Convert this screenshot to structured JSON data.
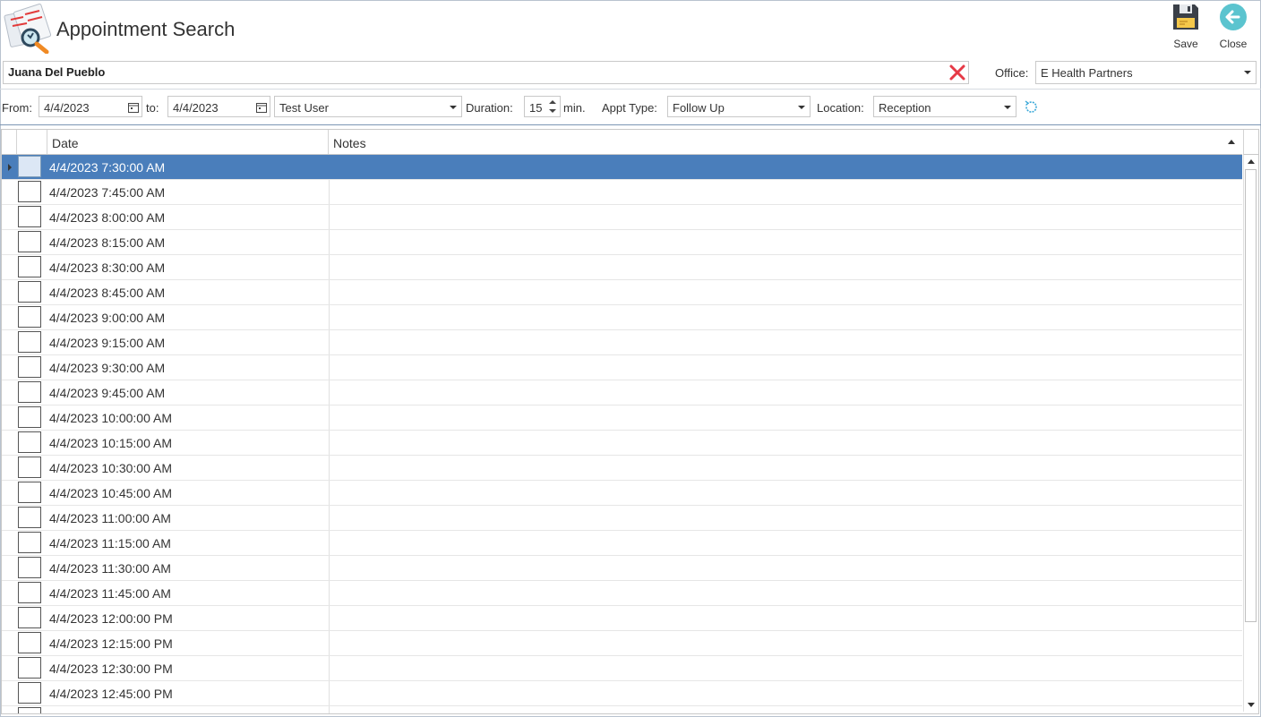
{
  "window": {
    "title": "Appointment Search"
  },
  "toolbar": {
    "save_label": "Save",
    "close_label": "Close"
  },
  "patient": {
    "name": "Juana Del Pueblo"
  },
  "office": {
    "label": "Office:",
    "value": "E Health Partners"
  },
  "filters": {
    "from_label": "From:",
    "from_date": "4/4/2023",
    "to_label": "to:",
    "to_date": "4/4/2023",
    "provider": "Test User",
    "duration_label": "Duration:",
    "duration_value": "15",
    "duration_unit": "min.",
    "appt_type_label": "Appt Type:",
    "appt_type_value": "Follow Up",
    "location_label": "Location:",
    "location_value": "Reception"
  },
  "grid": {
    "columns": [
      "Date",
      "Notes"
    ],
    "rows": [
      "4/4/2023 7:30:00 AM",
      "4/4/2023 7:45:00 AM",
      "4/4/2023 8:00:00 AM",
      "4/4/2023 8:15:00 AM",
      "4/4/2023 8:30:00 AM",
      "4/4/2023 8:45:00 AM",
      "4/4/2023 9:00:00 AM",
      "4/4/2023 9:15:00 AM",
      "4/4/2023 9:30:00 AM",
      "4/4/2023 9:45:00 AM",
      "4/4/2023 10:00:00 AM",
      "4/4/2023 10:15:00 AM",
      "4/4/2023 10:30:00 AM",
      "4/4/2023 10:45:00 AM",
      "4/4/2023 11:00:00 AM",
      "4/4/2023 11:15:00 AM",
      "4/4/2023 11:30:00 AM",
      "4/4/2023 11:45:00 AM",
      "4/4/2023 12:00:00 PM",
      "4/4/2023 12:15:00 PM",
      "4/4/2023 12:30:00 PM",
      "4/4/2023 12:45:00 PM",
      ""
    ],
    "selected_index": 0
  },
  "icons": {
    "app": "appointment-search-icon",
    "save": "floppy-disk-icon",
    "close": "back-arrow-icon",
    "clear": "red-x-icon",
    "calendar": "calendar-icon",
    "refresh": "refresh-icon"
  },
  "colors": {
    "selection": "#4a7ebb",
    "close_icon": "#5bc4cf",
    "clear_icon": "#e63946",
    "refresh_icon": "#3aa8d8"
  }
}
